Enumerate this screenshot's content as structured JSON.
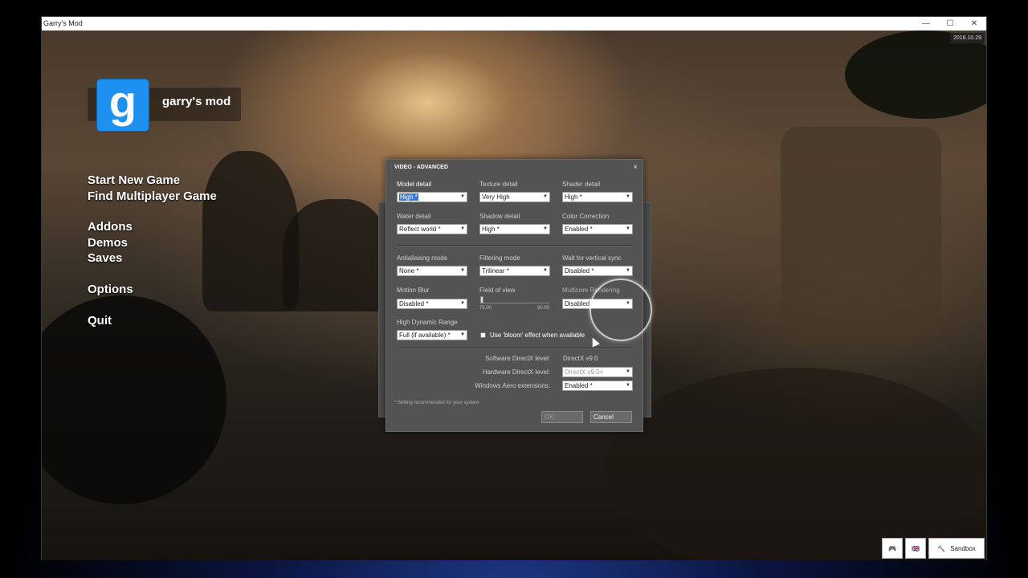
{
  "window": {
    "title": "Garry's Mod",
    "controls": [
      "—",
      "☐",
      "✕"
    ]
  },
  "date_stamp": "2016.10.29",
  "logo": {
    "letter": "g",
    "text": "garry's mod"
  },
  "main_menu": [
    "Start New Game",
    "Find Multiplayer Game",
    "Addons",
    "Demos",
    "Saves",
    "Options",
    "Quit"
  ],
  "dialog": {
    "title": "VIDEO - ADVANCED",
    "close": "×",
    "fields": {
      "model_detail": {
        "label": "Model detail",
        "value": "High *"
      },
      "texture_detail": {
        "label": "Texture detail",
        "value": "Very High"
      },
      "shader_detail": {
        "label": "Shader detail",
        "value": "High *"
      },
      "water_detail": {
        "label": "Water detail",
        "value": "Reflect world *"
      },
      "shadow_detail": {
        "label": "Shadow detail",
        "value": "High *"
      },
      "color_correction": {
        "label": "Color Correction",
        "value": "Enabled *"
      },
      "antialiasing": {
        "label": "Antialiasing mode",
        "value": "None *"
      },
      "filtering": {
        "label": "Filtering mode",
        "value": "Trilinear *"
      },
      "vsync": {
        "label": "Wait for vertical sync",
        "value": "Disabled *"
      },
      "motion_blur": {
        "label": "Motion Blur",
        "value": "Disabled *"
      },
      "fov": {
        "label": "Field of view",
        "min_label": "75.00",
        "max_label": "90.00",
        "value": 0
      },
      "multicore": {
        "label": "Multicore Rendering",
        "value": "Disabled"
      },
      "hdr": {
        "label": "High Dynamic Range",
        "value": "Full (if available) *"
      },
      "bloom": {
        "label": "Use 'bloom' effect when available",
        "checked": false
      },
      "software_dx": {
        "label": "Software DirectX level:",
        "value": "DirectX v9.0"
      },
      "hardware_dx": {
        "label": "Hardware DirectX level:",
        "value": "DirectX v9.0+"
      },
      "aero": {
        "label": "Windows Aero extensions:",
        "value": "Enabled *"
      }
    },
    "note": "* Setting recommended for your system",
    "ok": "OK",
    "cancel": "Cancel"
  },
  "bottom_bar": {
    "sandbox": "Sandbox"
  },
  "colors": {
    "logo_blue": "#1e90f0",
    "dialog_bg": "#535353",
    "selection": "#3a78d8"
  },
  "icons": [
    "gamepad-icon",
    "flag-icon",
    "hammer-icon"
  ]
}
